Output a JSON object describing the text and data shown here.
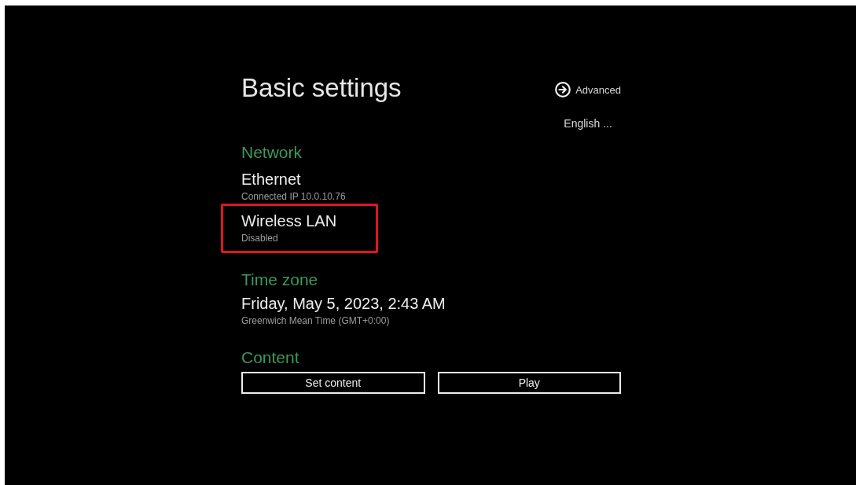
{
  "title": "Basic settings",
  "advanced_link": {
    "label": "Advanced"
  },
  "language": {
    "label": "English ..."
  },
  "sections": [
    {
      "kind": "list",
      "heading": "Network",
      "items": [
        {
          "name": "Ethernet",
          "status": "Connected IP 10.0.10.76",
          "highlighted": false
        },
        {
          "name": "Wireless LAN",
          "status": "Disabled",
          "highlighted": true
        }
      ]
    },
    {
      "kind": "clock",
      "heading": "Time zone",
      "items": [
        {
          "name": "Friday, May 5, 2023, 2:43 AM",
          "status": "Greenwich Mean Time (GMT+0:00)",
          "highlighted": false
        }
      ]
    },
    {
      "kind": "actions",
      "heading": "Content",
      "buttons": [
        "Set content",
        "Play"
      ]
    }
  ]
}
